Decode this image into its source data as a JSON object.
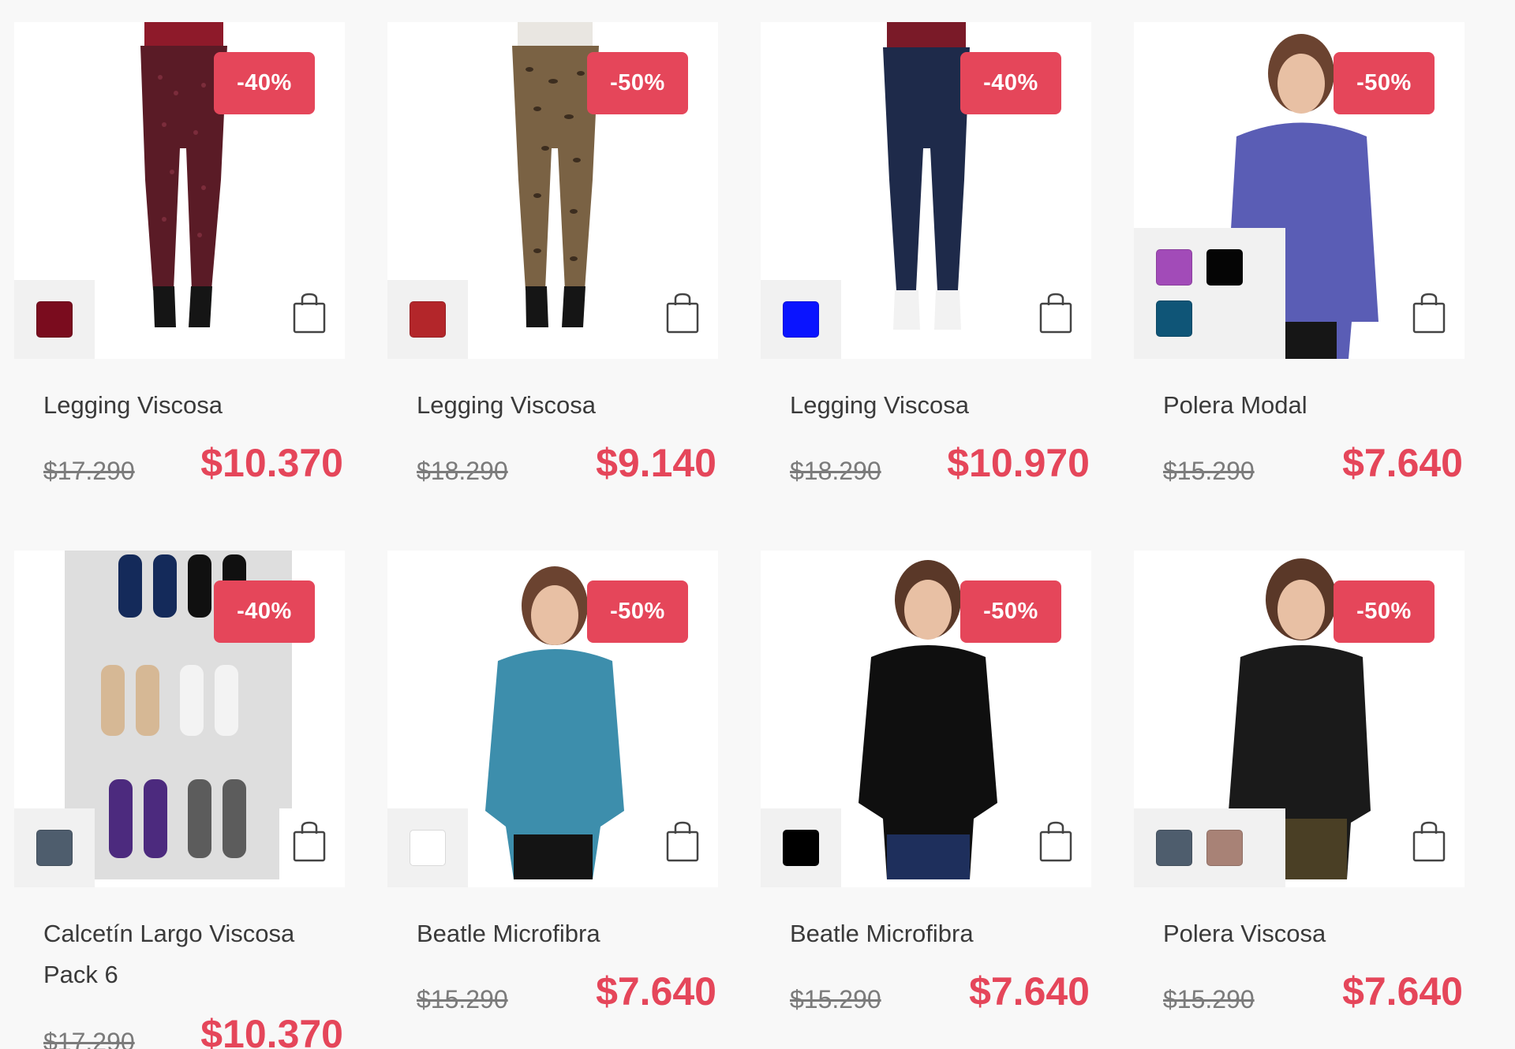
{
  "products": [
    {
      "name": "Legging Viscosa",
      "discount": "-40%",
      "old_price": "$17.290",
      "new_price": "$10.370",
      "swatches": [
        "#7a0c1e"
      ],
      "image": "leggings-patterned-burgundy"
    },
    {
      "name": "Legging Viscosa",
      "discount": "-50%",
      "old_price": "$18.290",
      "new_price": "$9.140",
      "swatches": [
        "#b3262a"
      ],
      "image": "leggings-leopard-print"
    },
    {
      "name": "Legging Viscosa",
      "discount": "-40%",
      "old_price": "$18.290",
      "new_price": "$10.970",
      "swatches": [
        "#0a14ff"
      ],
      "image": "leggings-navy"
    },
    {
      "name": "Polera Modal",
      "discount": "-50%",
      "old_price": "$15.290",
      "new_price": "$7.640",
      "swatches": [
        "#a24bb8",
        "#050505",
        "#0f5577"
      ],
      "image": "woman-purple-longsleeve"
    },
    {
      "name": "Calcetín Largo Viscosa Pack 6",
      "discount": "-40%",
      "old_price": "$17.290",
      "new_price": "$10.370",
      "swatches": [
        "#4e5d6d"
      ],
      "image": "socks-pack-6"
    },
    {
      "name": "Beatle Microfibra",
      "discount": "-50%",
      "old_price": "$15.290",
      "new_price": "$7.640",
      "swatches": [
        "#ffffff"
      ],
      "image": "woman-teal-turtleneck"
    },
    {
      "name": "Beatle Microfibra",
      "discount": "-50%",
      "old_price": "$15.290",
      "new_price": "$7.640",
      "swatches": [
        "#000000"
      ],
      "image": "woman-black-turtleneck"
    },
    {
      "name": "Polera Viscosa",
      "discount": "-50%",
      "old_price": "$15.290",
      "new_price": "$7.640",
      "swatches": [
        "#4e5d6d",
        "#a88276"
      ],
      "image": "woman-black-ribbed-top"
    }
  ],
  "icons": {
    "cart": "shopping-bag-icon"
  }
}
